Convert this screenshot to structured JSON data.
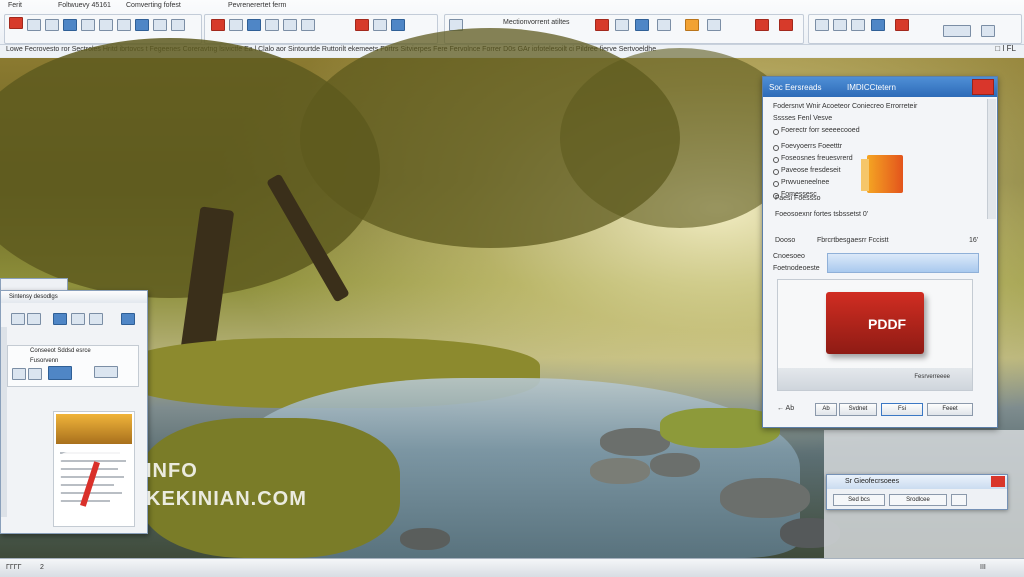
{
  "ribbon": {
    "tab_1": "Ferit",
    "tab_2": "Foltwuevy 45161",
    "tab_3": "Comverting fofest",
    "group_1_label": "Pevrenerertet ferm",
    "group_2_label": "Mectionvorrent atiltes",
    "status_line": "Lowe Fecrovesto ror Sectroles Hritd ibrtovcs t Fegeenes Coreravtng lsivictfe Ea l Clalo aor Sintourtde Ruttorilt ekemeets Fortrs Sitvierpes Fere Fervolnce Forrer D0s GAr iofotelesoilt ci Pildree fierve Sertvoeldhe",
    "window_controls": "□ ǀ FL"
  },
  "dialog": {
    "title_left": "Soc Eersreads",
    "title_right": "IMDICCtetern",
    "heading": "Fodersnvt Wnir Acoeteor Coniecreo Errorreteir",
    "subheading": "Sssses Fenl Vesve",
    "options": [
      "Foerectr forr seeeecooed",
      "Foevyoerrs Foeetttr",
      "Foseosnes freuesvrerd",
      "Paveose fresdeseit",
      "Prwvueneelnee",
      "Fomessesc"
    ],
    "section_label": "Faesi Foessso",
    "section_detail": "Foeosoexnr fortes tsbssetst 0'",
    "output_label": "Dooso",
    "output_value": "Fbrcrtbesgaesrr Fccistt",
    "output_flag": "16'",
    "source_label": "Cnoesoeo",
    "dest_label": "Foetnodeoeste",
    "preview_label": "PDDF",
    "preview_caption": "Fesrverreeee",
    "btn_back": "Ab",
    "btn_browse": "Svdnet",
    "btn_ok": "Fsi",
    "btn_cancel": "Feeet",
    "footer_icons": "← Ab"
  },
  "mini_dialog": {
    "title": "Sr Gieofecrsoees",
    "btn_1": "Sed bcs",
    "btn_2": "Srodlcee"
  },
  "doc_window": {
    "title": "Sintensy desodlgs",
    "panel_text": "Conseeot Sddsd esrce",
    "panel_sub": "Fusorvenn"
  },
  "watermark": {
    "line1": "INFO",
    "line2": "KEKINIAN.COM"
  },
  "taskbar": {
    "item_1": "ΓΓΓΓ",
    "item_2": "2",
    "item_3": "ΙΙΙ"
  },
  "colors": {
    "dialog_titlebar": "#2d6bb8",
    "pdf_red": "#c4251b",
    "pdf_orange": "#f5a623"
  }
}
